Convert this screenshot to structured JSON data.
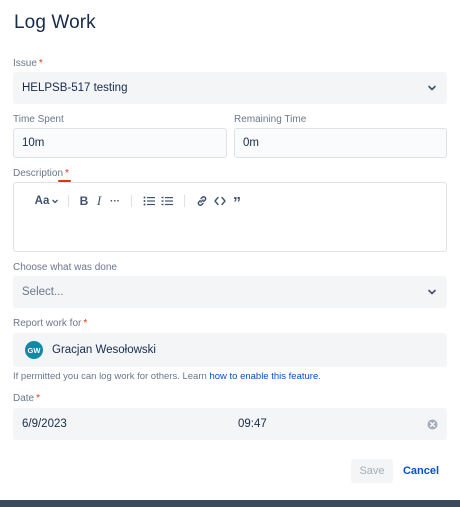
{
  "dialog": {
    "title": "Log Work"
  },
  "issue": {
    "label": "Issue",
    "required_mark": "*",
    "value": "HELPSB-517 testing"
  },
  "time_spent": {
    "label": "Time Spent",
    "value": "10m"
  },
  "remaining_time": {
    "label": "Remaining Time",
    "value": "0m"
  },
  "description": {
    "label": "Description",
    "required_mark": "*",
    "toolbar": {
      "text_style": "Aa",
      "bold": "B",
      "italic": "I",
      "more": "···",
      "quote": "”"
    }
  },
  "choose_done": {
    "label": "Choose what was done",
    "placeholder": "Select..."
  },
  "report_for": {
    "label": "Report work for",
    "required_mark": "*",
    "avatar_initials": "GW",
    "user_name": "Gracjan Wesołowski"
  },
  "helper": {
    "text": "If permitted you can log work for others. Learn ",
    "link": "how to enable this feature",
    "end": "."
  },
  "date": {
    "label": "Date",
    "required_mark": "*",
    "date_value": "6/9/2023",
    "time_value": "09:47"
  },
  "actions": {
    "save_label": "Save",
    "cancel_label": "Cancel"
  },
  "colors": {
    "accent": "#0052cc",
    "required": "#de350b",
    "avatar": "#0e8aa8"
  }
}
